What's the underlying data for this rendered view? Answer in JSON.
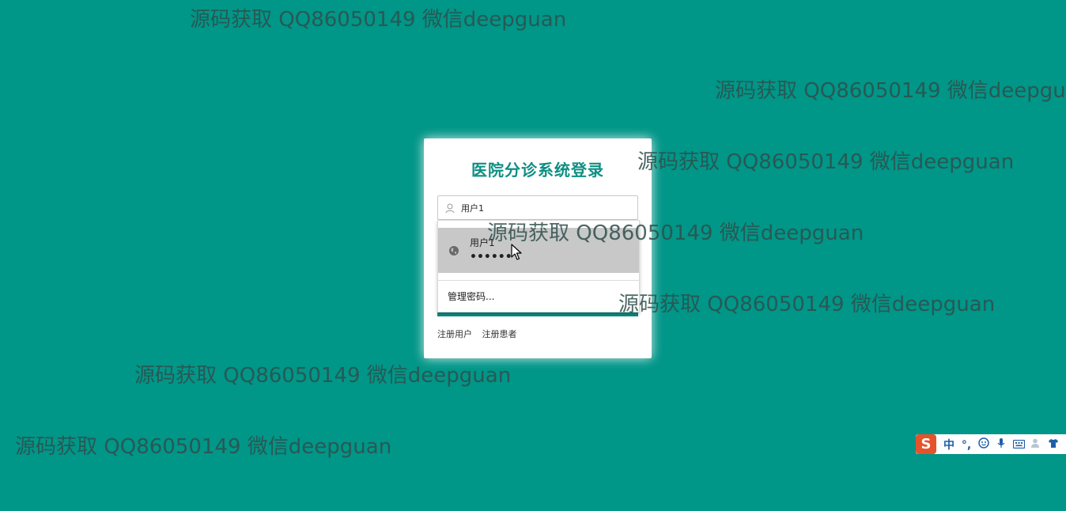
{
  "login": {
    "title": "医院分诊系统登录",
    "username_value": "用户1",
    "register_user": "注册用户",
    "register_patient": "注册患者"
  },
  "autofill": {
    "entry_username": "用户1",
    "entry_password_mask": "••••••",
    "manage_passwords": "管理密码..."
  },
  "watermarks": [
    "源码获取 QQ86050149 微信deepguan",
    "源码获取 QQ86050149 微信deepguan",
    "源码获取 QQ86050149 微信deepguan",
    "源码获取 QQ86050149 微信deepguan",
    "源码获取 QQ86050149 微信deepguan",
    "源码获取 QQ86050149 微信deepguan",
    "源码获取 QQ86050149 微信deepguan"
  ],
  "ime": {
    "logo": "S",
    "mode": "中",
    "punct": "°,"
  },
  "colors": {
    "background": "#009688",
    "title": "#0d8f83",
    "button": "#0e8c80",
    "autofill_highlight": "#c8c8c8"
  },
  "icons": {
    "username": "user-icon",
    "autofill_entry": "globe-icon",
    "cursor": "mouse-cursor-icon",
    "ime": [
      "sogou-logo-icon",
      "emoji-icon",
      "microphone-icon",
      "keyboard-icon",
      "user-icon",
      "shirt-icon",
      "grid-icon"
    ]
  }
}
